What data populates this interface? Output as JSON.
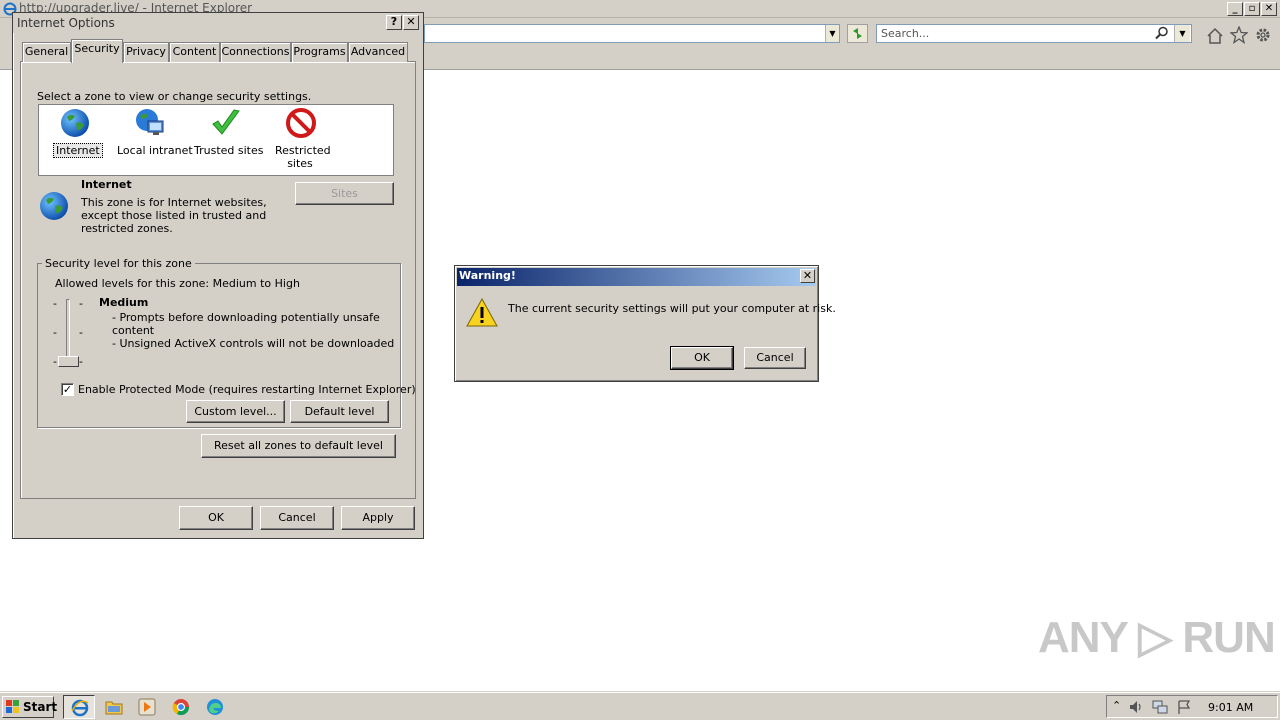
{
  "browser": {
    "title": "http://upgrader.live/ - Internet Explorer",
    "search_placeholder": "Search..."
  },
  "internet_options": {
    "title": "Internet Options",
    "help_label": "?",
    "close_label": "✕",
    "tabs": [
      {
        "label": "General"
      },
      {
        "label": "Security"
      },
      {
        "label": "Privacy"
      },
      {
        "label": "Content"
      },
      {
        "label": "Connections"
      },
      {
        "label": "Programs"
      },
      {
        "label": "Advanced"
      }
    ],
    "active_tab": "Security",
    "zone_prompt": "Select a zone to view or change security settings.",
    "zones": [
      {
        "label": "Internet",
        "icon": "globe-icon"
      },
      {
        "label": "Local intranet",
        "icon": "intranet-icon"
      },
      {
        "label": "Trusted sites",
        "icon": "checkmark-icon"
      },
      {
        "label": "Restricted sites",
        "label_line1": "Restricted",
        "label_line2": "sites",
        "icon": "restricted-icon"
      }
    ],
    "selected_zone": {
      "name": "Internet",
      "description_lines": [
        "This zone is for Internet websites,",
        "except those listed in trusted and",
        "restricted zones."
      ]
    },
    "sites_button": "Sites",
    "security_level": {
      "group_label": "Security level for this zone",
      "allowed": "Allowed levels for this zone: Medium to High",
      "level_name": "Medium",
      "points": [
        "- Prompts before downloading potentially unsafe",
        "content",
        "- Unsigned ActiveX controls will not be downloaded"
      ]
    },
    "protected_mode": {
      "label": "Enable Protected Mode (requires restarting Internet Explorer)",
      "checked": true,
      "check_mark": "✓"
    },
    "custom_level_button": "Custom level...",
    "default_level_button": "Default level",
    "reset_button": "Reset all zones to default level",
    "ok_button": "OK",
    "cancel_button": "Cancel",
    "apply_button": "Apply"
  },
  "warning": {
    "title": "Warning!",
    "close_label": "✕",
    "message": "The current security settings will put your computer at risk.",
    "ok_button": "OK",
    "cancel_button": "Cancel"
  },
  "taskbar": {
    "start_label": "Start",
    "clock": "9:01 AM",
    "tray_arrow": "⌃"
  },
  "watermark": "ANY ▷ RUN",
  "colors": {
    "title_gradient_start": "#0a246a",
    "title_gradient_end": "#a6caf0",
    "dialog_face": "#d4d0c8"
  }
}
